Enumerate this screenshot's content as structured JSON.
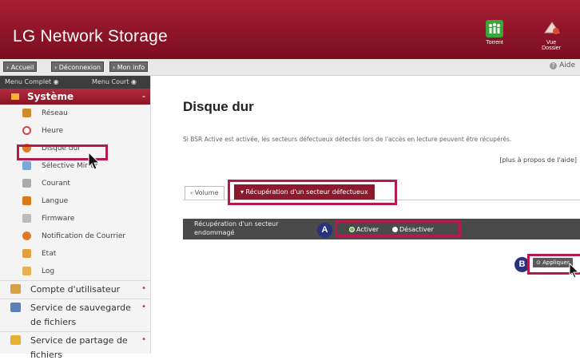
{
  "header": {
    "brand": "LG Network Storage",
    "icons": [
      {
        "name": "torrent-icon",
        "label": "Torrent",
        "color": "#3aa53a"
      },
      {
        "name": "folder-view-icon",
        "label": "Vue Dossier",
        "color": "#e9d0c4"
      }
    ]
  },
  "nav": {
    "buttons": [
      "› Accueil",
      "› Déconnexion",
      "› Mon info"
    ],
    "help": "Aide"
  },
  "sidebar": {
    "menu_full": "Menu Complet ◉",
    "menu_short": "Menu Court ◉",
    "section": "Système",
    "items": [
      {
        "label": "Réseau",
        "icon": "network-icon",
        "color": "#d08a2c"
      },
      {
        "label": "Heure",
        "icon": "clock-icon",
        "color": "#d44"
      },
      {
        "label": "Disque dur",
        "icon": "hard-disk-icon",
        "color": "#e07a2a"
      },
      {
        "label": "Sélective Mirror",
        "icon": "mirror-icon",
        "color": "#7aa7d6"
      },
      {
        "label": "Courant",
        "icon": "power-icon",
        "color": "#aaaaaa"
      },
      {
        "label": "Langue",
        "icon": "language-icon",
        "color": "#d67a1a"
      },
      {
        "label": "Firmware",
        "icon": "firmware-icon",
        "color": "#bbbbbb"
      },
      {
        "label": "Notification de Courrier",
        "icon": "mail-notification-icon",
        "color": "#e07a2a"
      },
      {
        "label": "Etat",
        "icon": "status-icon",
        "color": "#e0a040"
      },
      {
        "label": "Log",
        "icon": "log-icon",
        "color": "#e8b050"
      }
    ],
    "groups": [
      {
        "label": "Compte d'utilisateur",
        "icon": "user-account-icon",
        "color": "#d8a040"
      },
      {
        "label": "Service de sauvegarde de fichiers",
        "icon": "backup-icon",
        "color": "#5b7fb8"
      },
      {
        "label": "Service de partage de fichiers",
        "icon": "share-icon",
        "color": "#e8b030"
      }
    ]
  },
  "main": {
    "title": "Disque dur",
    "description": "Si BSR Active est activée, les secteurs défectueux détectés lors de l'accès en lecture peuvent être récupérés.",
    "more_help": "[plus à propos de l'aide]",
    "tabs": [
      "› Volume",
      "▾ Récupération d'un secteur défectueux"
    ],
    "setting_label": "Récupération d'un secteur endommagé",
    "radio_on": "Activer",
    "radio_off": "Désactiver",
    "apply": "⊙ Appliquer",
    "marker_a": "A",
    "marker_b": "B"
  }
}
